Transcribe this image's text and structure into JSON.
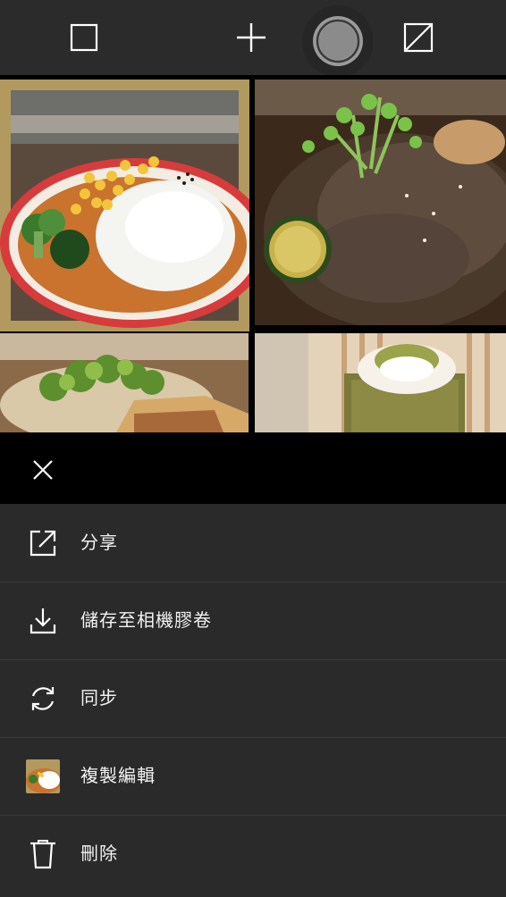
{
  "toolbar": {
    "icons": [
      "square-icon",
      "plus-icon",
      "shutter-icon",
      "exposure-icon"
    ]
  },
  "grid": {
    "photos": [
      {
        "subject": "curry-rice-plate",
        "selected": true
      },
      {
        "subject": "grilled-beef-with-sprouts-and-lime",
        "selected": false
      },
      {
        "subject": "salad-and-pastry",
        "selected": false
      },
      {
        "subject": "matcha-cake-with-cream",
        "selected": false
      }
    ]
  },
  "sheet": {
    "close_icon": "close-icon",
    "items": [
      {
        "label": "分享",
        "icon": "share-icon"
      },
      {
        "label": "儲存至相機膠卷",
        "icon": "download-icon"
      },
      {
        "label": "同步",
        "icon": "sync-icon"
      },
      {
        "label": "複製編輯",
        "icon": "photo-thumbnail-icon"
      },
      {
        "label": "刪除",
        "icon": "trash-icon"
      }
    ]
  },
  "colors": {
    "toolbar_bg": "#2b2b2b",
    "sheet_bg": "#2a2a2a",
    "sheet_header_bg": "#000000",
    "selection_border": "#b29a5e",
    "text": "#f2f2f2"
  }
}
